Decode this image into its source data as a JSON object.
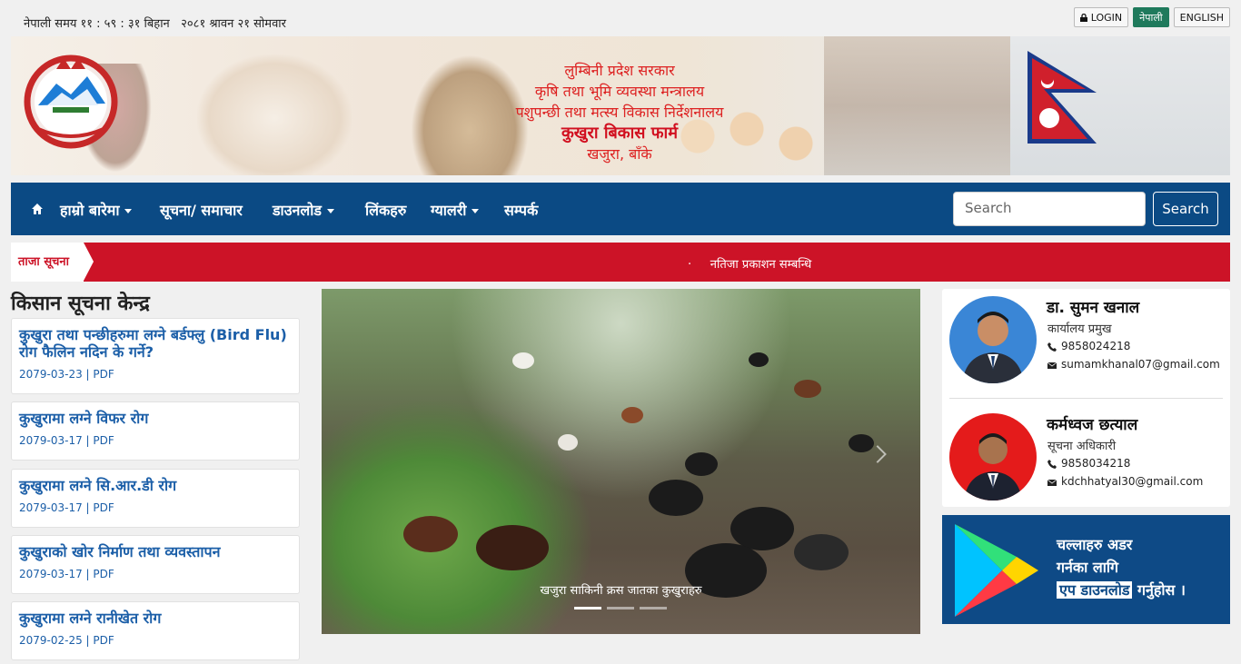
{
  "topbar": {
    "datetime": "नेपाली समय ११ : ५९ : ३१ बिहान   २०८१ श्रावन २१ सोमवार",
    "login": "LOGIN",
    "nepali": "नेपाली",
    "english": "ENGLISH"
  },
  "banner": {
    "line1": "लुम्बिनी प्रदेश सरकार",
    "line2": "कृषि तथा भूमि व्यवस्था मन्त्रालय",
    "line3": "पशुपन्छी तथा मत्स्य विकास निर्देशनालय",
    "farm": "कुखुरा बिकास फार्म",
    "place": "खजुरा, बाँके"
  },
  "nav": {
    "items": [
      {
        "label": "हाम्रो बारेमा",
        "dropdown": true
      },
      {
        "label": "सूचना/ समाचार",
        "dropdown": false
      },
      {
        "label": "डाउनलोड",
        "dropdown": true
      },
      {
        "label": "लिंकहरु",
        "dropdown": false
      },
      {
        "label": "ग्यालरी",
        "dropdown": true
      },
      {
        "label": "सम्पर्क",
        "dropdown": false
      }
    ],
    "search_placeholder": "Search",
    "search_button": "Search"
  },
  "ticker": {
    "label": "ताजा सूचना",
    "text": "·     नतिजा प्रकाशन सम्बन्धि"
  },
  "kisan": {
    "title": "किसान सूचना केन्द्र",
    "items": [
      {
        "title": "कुखुरा तथा पन्छीहरुमा लग्ने बर्डफ्लु (Bird Flu) रोग फैलिन नदिन के गर्ने?",
        "meta": "2079-03-23 | PDF"
      },
      {
        "title": "कुखुरामा लग्ने विफर रोग",
        "meta": "2079-03-17 | PDF"
      },
      {
        "title": "कुखुरामा लग्ने सि.आर.डी रोग",
        "meta": "2079-03-17 | PDF"
      },
      {
        "title": "कुखुराको खोर निर्माण तथा व्यवस्तापन",
        "meta": "2079-03-17 | PDF"
      },
      {
        "title": "कुखुरामा लग्ने रानीखेत रोग",
        "meta": "2079-02-25 | PDF"
      }
    ]
  },
  "slider": {
    "caption": "खजुरा साकिनी क्रस जातका कुखुराहरु",
    "slides": 3,
    "active": 1
  },
  "people": [
    {
      "name": "डा. सुमन खनाल",
      "role": "कार्यालय प्रमुख",
      "phone": "9858024218",
      "email": "sumamkhanal07@gmail.com",
      "bg": "#3a86d6"
    },
    {
      "name": "कर्मध्वज छत्याल",
      "role": "सूचना अधिकारी",
      "phone": "9858034218",
      "email": "kdchhatyal30@gmail.com",
      "bg": "#e41b1b"
    }
  ],
  "app": {
    "line1": "चल्लाहरु अडर",
    "line2": "गर्नका लागि",
    "line3a": "एप डाउनलोड",
    "line3b": " गर्नुहोस ।"
  },
  "colors": {
    "nav": "#0b4a84",
    "ticker": "#cc1327",
    "link": "#1c5fa8",
    "banner_text": "#dd2222"
  }
}
